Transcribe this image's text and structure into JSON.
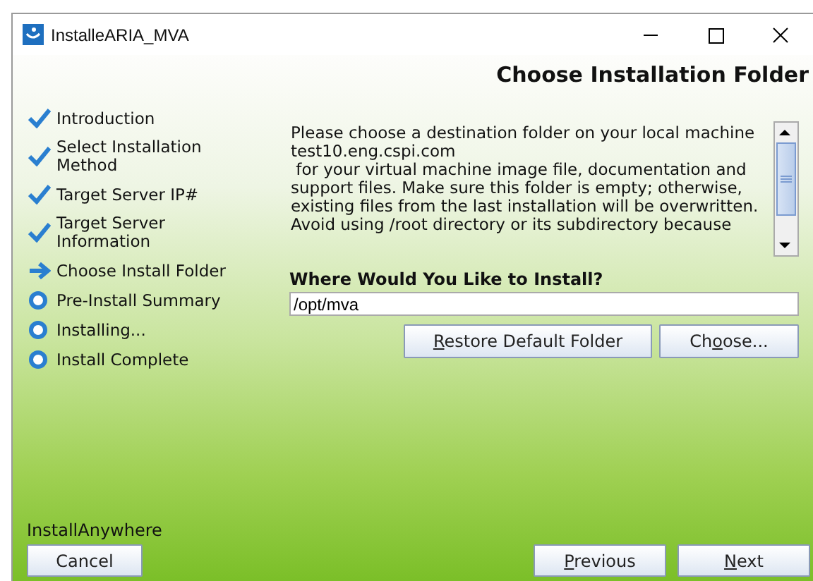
{
  "window": {
    "title": "InstalleARIA_MVA"
  },
  "header": {
    "title": "Choose Installation Folder"
  },
  "steps": [
    {
      "label": "Introduction",
      "kind": "done"
    },
    {
      "label": "Select Installation Method",
      "kind": "done"
    },
    {
      "label": "Target Server IP#",
      "kind": "done"
    },
    {
      "label": "Target Server Information",
      "kind": "done"
    },
    {
      "label": "Choose Install Folder",
      "kind": "current"
    },
    {
      "label": "Pre-Install Summary",
      "kind": "pending"
    },
    {
      "label": "Installing...",
      "kind": "pending"
    },
    {
      "label": "Install Complete",
      "kind": "pending"
    }
  ],
  "description": [
    "Please choose a destination folder on your local machine",
    "test10.eng.cspi.com",
    " for your virtual machine image file, documentation and support files. Make sure this folder is empty; otherwise, existing files from the last installation will be overwritten. Avoid using /root directory or its subdirectory because"
  ],
  "install_prompt": "Where Would You Like to Install?",
  "install_path": {
    "value": "/opt/mva"
  },
  "folder_buttons": [
    {
      "key": "R",
      "post": "estore Default Folder"
    },
    {
      "pre": "Ch",
      "key": "o",
      "post": "ose..."
    }
  ],
  "brand": "InstallAnywhere",
  "left_buttons": [
    {
      "pre": "Cancel"
    }
  ],
  "right_buttons": [
    {
      "key": "P",
      "post": "revious"
    },
    {
      "key": "N",
      "post": "ext"
    }
  ]
}
